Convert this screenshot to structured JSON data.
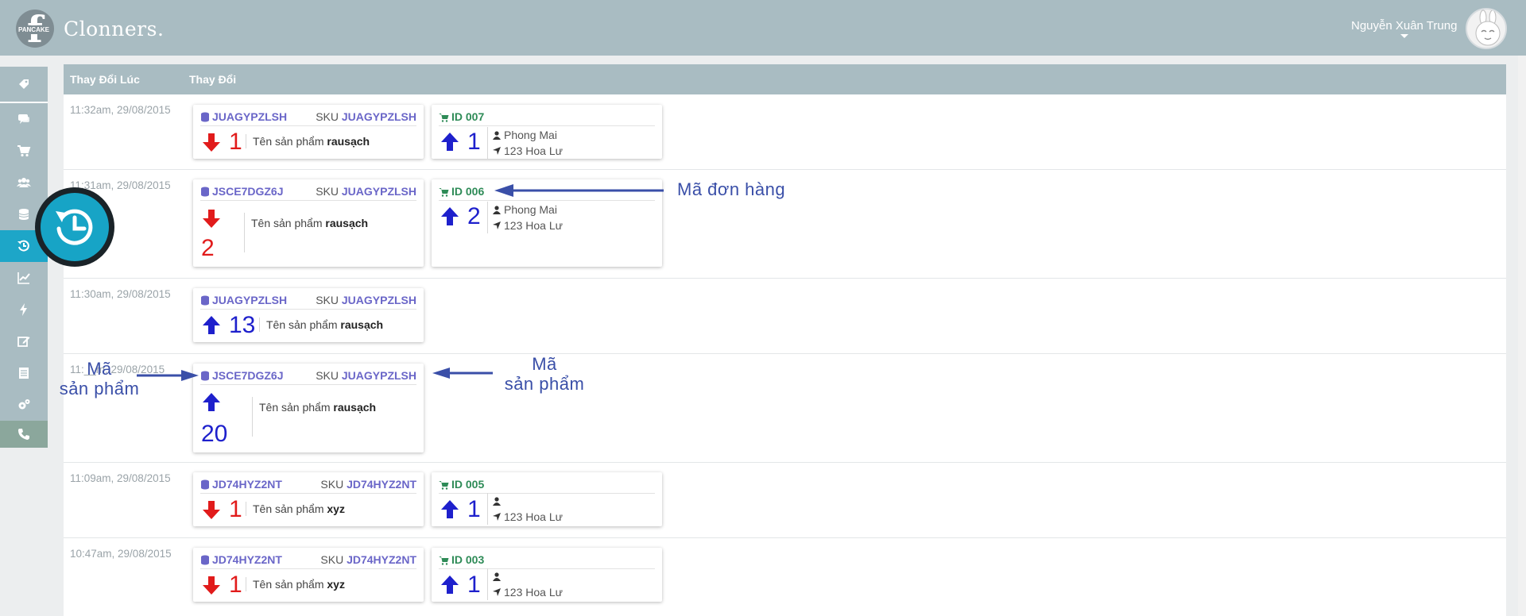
{
  "app": {
    "brand": "Clonners.",
    "logo_text": "PANCAKE",
    "user_name": "Nguyễn Xuân Trung"
  },
  "table": {
    "col_time": "Thay Đổi Lúc",
    "col_change": "Thay Đổi"
  },
  "labels": {
    "sku_prefix": "SKU",
    "product_prefix": "Tên sản phẩm"
  },
  "rows": [
    {
      "time": "11:32am, 29/08/2015",
      "code": "JUAGYPZLSH",
      "sku": "JUAGYPZLSH",
      "direction": "down",
      "qty": "1",
      "product": "rausạch",
      "order": {
        "id": "ID 007",
        "direction": "up",
        "qty": "1",
        "customer": "Phong Mai",
        "address": "123 Hoa Lư"
      }
    },
    {
      "time": "11:31am, 29/08/2015",
      "code": "JSCE7DGZ6J",
      "sku": "JUAGYPZLSH",
      "direction": "down",
      "qty": "2",
      "product": "rausạch",
      "order": {
        "id": "ID 006",
        "direction": "up",
        "qty": "2",
        "customer": "Phong Mai",
        "address": "123 Hoa Lư"
      }
    },
    {
      "time": "11:30am, 29/08/2015",
      "code": "JUAGYPZLSH",
      "sku": "JUAGYPZLSH",
      "direction": "up",
      "qty": "13",
      "product": "rausạch"
    },
    {
      "time": "11:__m, 29/08/2015",
      "code": "JSCE7DGZ6J",
      "sku": "JUAGYPZLSH",
      "direction": "up",
      "qty": "20",
      "product": "rausạch"
    },
    {
      "time": "11:09am, 29/08/2015",
      "code": "JD74HYZ2NT",
      "sku": "JD74HYZ2NT",
      "direction": "down",
      "qty": "1",
      "product": "xyz",
      "order": {
        "id": "ID 005",
        "direction": "up",
        "qty": "1",
        "customer": "",
        "address": "123 Hoa Lư"
      }
    },
    {
      "time": "10:47am, 29/08/2015",
      "code": "JD74HYZ2NT",
      "sku": "JD74HYZ2NT",
      "direction": "down",
      "qty": "1",
      "product": "xyz",
      "order": {
        "id": "ID 003",
        "direction": "up",
        "qty": "1",
        "customer": "",
        "address": "123 Hoa Lư"
      }
    }
  ],
  "annotations": {
    "order_code": "Mã đơn hàng",
    "product_code_left_1": "Mã",
    "product_code_left_2": "sản phẩm",
    "product_code_right_1": "Mã",
    "product_code_right_2": "sản phẩm"
  },
  "sidebar_icons": [
    "tag-icon",
    "chat-icon",
    "cart-icon",
    "users-icon",
    "database-icon",
    "history-icon",
    "chart-icon",
    "bolt-icon",
    "edit-icon",
    "list-icon",
    "settings-icon",
    "phone-icon"
  ],
  "colors": {
    "topbar": "#a9bcc2",
    "active": "#1da6c8",
    "down": "#e11b1b",
    "up": "#1e20cc",
    "code": "#6a66c8",
    "order": "#2e8b57",
    "annotation": "#3a4fa8"
  }
}
